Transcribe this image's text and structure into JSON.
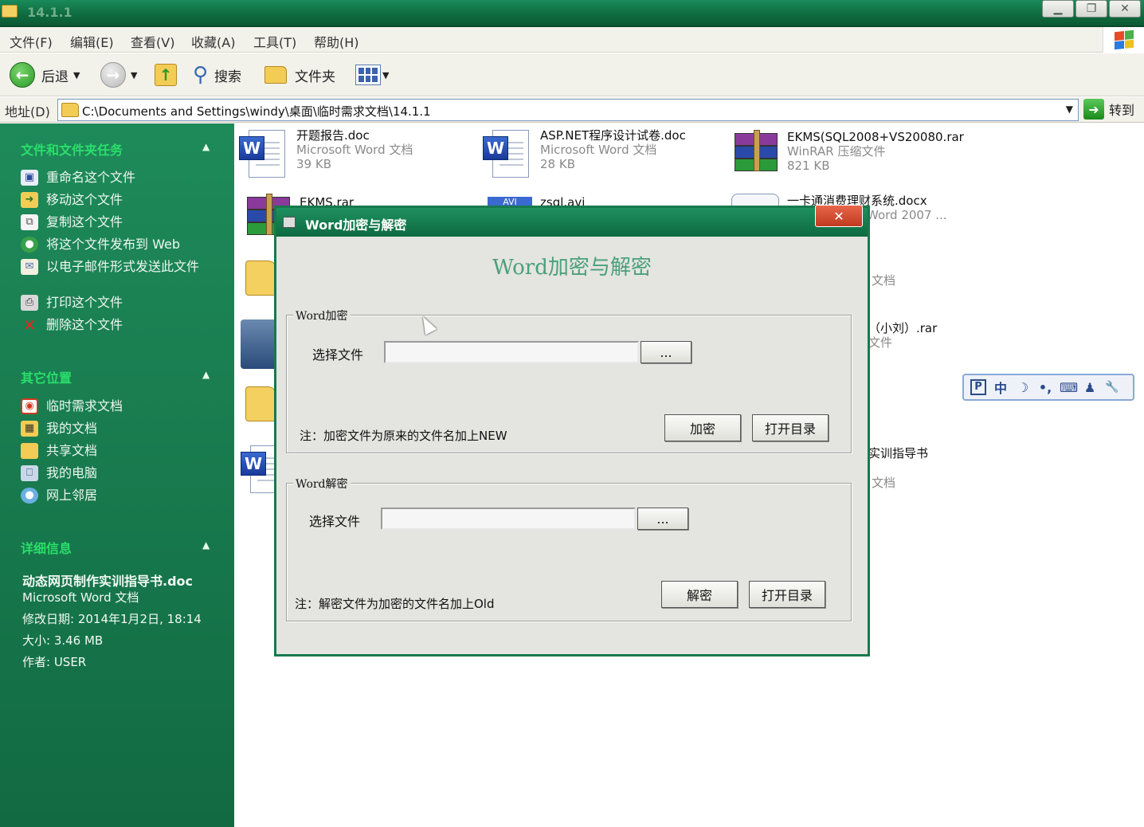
{
  "window": {
    "title": "14.1.1",
    "buttons": [
      "▁",
      "❐",
      "✕"
    ]
  },
  "menu": [
    "文件(F)",
    "编辑(E)",
    "查看(V)",
    "收藏(A)",
    "工具(T)",
    "帮助(H)"
  ],
  "toolbar": {
    "back": "后退",
    "search": "搜索",
    "folders": "文件夹"
  },
  "address": {
    "label": "地址(D)",
    "path": "C:\\Documents and Settings\\windy\\桌面\\临时需求文档\\14.1.1",
    "go": "转到"
  },
  "sidebar": {
    "tasks_title": "文件和文件夹任务",
    "tasks": [
      {
        "label": "重命名这个文件",
        "icon": "rename-icon"
      },
      {
        "label": "移动这个文件",
        "icon": "move-icon"
      },
      {
        "label": "复制这个文件",
        "icon": "copy-icon"
      },
      {
        "label": "将这个文件发布到 Web",
        "icon": "web-publish-icon"
      },
      {
        "label": "以电子邮件形式发送此文件",
        "icon": "email-icon"
      },
      {
        "label": "打印这个文件",
        "icon": "printer-icon"
      },
      {
        "label": "删除这个文件",
        "icon": "delete-icon"
      }
    ],
    "places_title": "其它位置",
    "places": [
      {
        "label": "临时需求文档",
        "icon": "folder-icon"
      },
      {
        "label": "我的文档",
        "icon": "documents-icon"
      },
      {
        "label": "共享文档",
        "icon": "shared-folder-icon"
      },
      {
        "label": "我的电脑",
        "icon": "computer-icon"
      },
      {
        "label": "网上邻居",
        "icon": "network-icon"
      }
    ],
    "details_title": "详细信息",
    "details": {
      "filename": "动态网页制作实训指导书.doc",
      "type": "Microsoft Word 文档",
      "modified": "修改日期: 2014年1月2日, 18:14",
      "size": "大小: 3.46 MB",
      "author": "作者: USER"
    }
  },
  "files": [
    {
      "name": "开题报告.doc",
      "type": "Microsoft Word 文档",
      "size": "39 KB"
    },
    {
      "name": "ASP.NET程序设计试卷.doc",
      "type": "Microsoft Word 文档",
      "size": "28 KB"
    },
    {
      "name": "EKMS(SQL2008+VS20080.rar",
      "type": "WinRAR 压缩文件",
      "size": "821 KB"
    },
    {
      "name": "EKMS.rar"
    },
    {
      "name": "zsql.avi"
    },
    {
      "name": "一卡通消费理财系统.docx",
      "type": "Word 2007 ..."
    }
  ],
  "partial": {
    "t1": "文档",
    "t2": "（小刘）.rar",
    "t3": "文件",
    "t4": "实训指导书",
    "t5": "文档"
  },
  "ime": [
    "P",
    "中",
    "☽",
    "•,",
    "⌨",
    "♟",
    "🔧"
  ],
  "dialog": {
    "title": "Word加密与解密",
    "heading": "Word加密与解密",
    "encrypt": {
      "legend": "Word加密",
      "label": "选择文件",
      "value": "",
      "browse": "...",
      "action": "加密",
      "open_dir": "打开目录",
      "note": "注：加密文件为原来的文件名加上NEW"
    },
    "decrypt": {
      "legend": "Word解密",
      "label": "选择文件",
      "value": "",
      "browse": "...",
      "action": "解密",
      "open_dir": "打开目录",
      "note": "注：解密文件为加密的文件名加上Old"
    }
  }
}
